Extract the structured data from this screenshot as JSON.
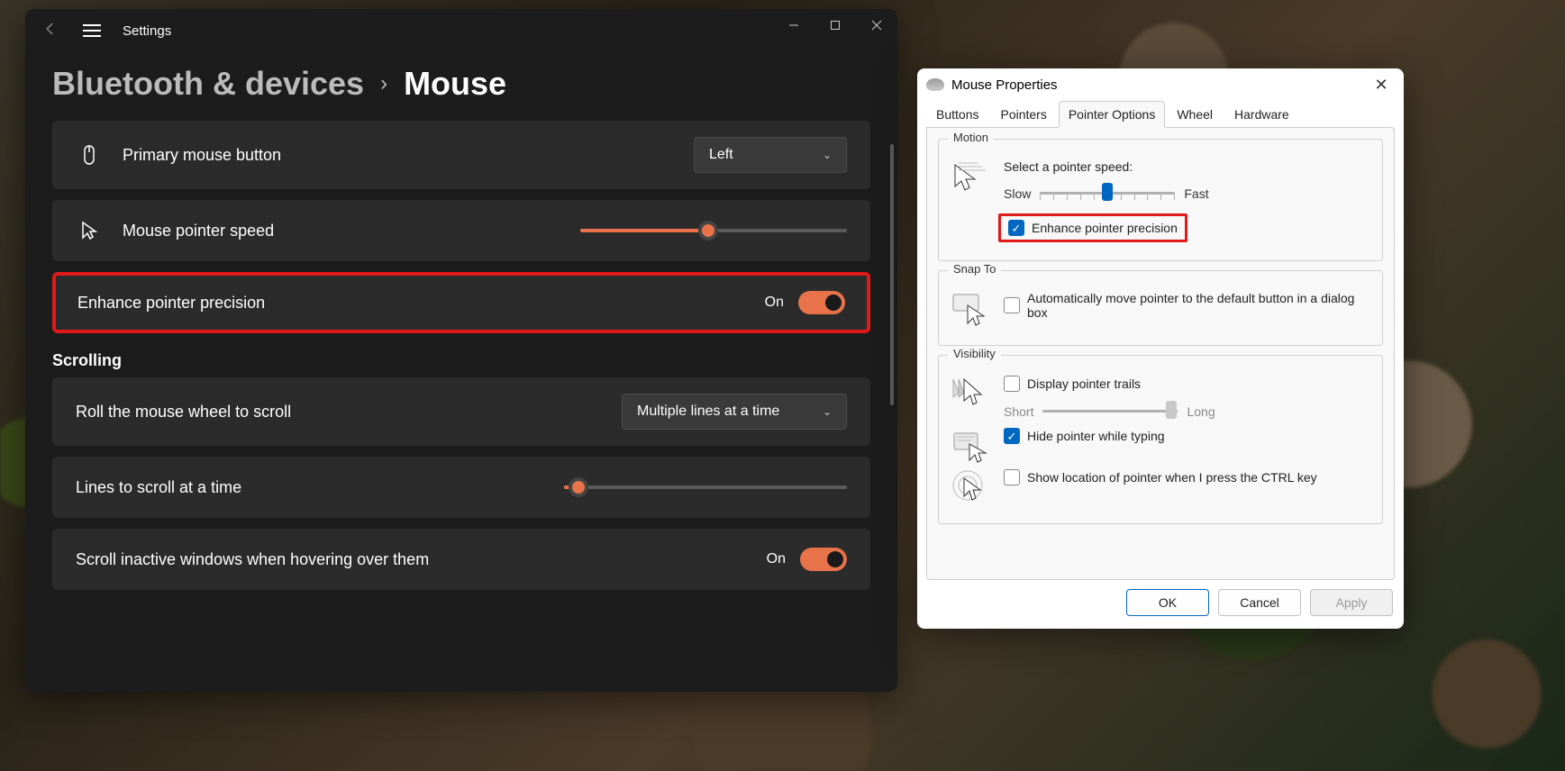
{
  "settings": {
    "app_title": "Settings",
    "breadcrumb_parent": "Bluetooth & devices",
    "breadcrumb_current": "Mouse",
    "primary_button_label": "Primary mouse button",
    "primary_button_value": "Left",
    "pointer_speed_label": "Mouse pointer speed",
    "pointer_speed_value_pct": 48,
    "enhance_precision_label": "Enhance pointer precision",
    "enhance_precision_state": "On",
    "scrolling_section": "Scrolling",
    "roll_wheel_label": "Roll the mouse wheel to scroll",
    "roll_wheel_value": "Multiple lines at a time",
    "lines_scroll_label": "Lines to scroll at a time",
    "lines_scroll_value_pct": 5,
    "scroll_inactive_label": "Scroll inactive windows when hovering over them",
    "scroll_inactive_state": "On"
  },
  "props": {
    "title": "Mouse Properties",
    "tabs": [
      "Buttons",
      "Pointers",
      "Pointer Options",
      "Wheel",
      "Hardware"
    ],
    "active_tab": "Pointer Options",
    "motion": {
      "legend": "Motion",
      "speed_label": "Select a pointer speed:",
      "slow": "Slow",
      "fast": "Fast",
      "speed_pos_pct": 50,
      "enhance_label": "Enhance pointer precision",
      "enhance_checked": true
    },
    "snapto": {
      "legend": "Snap To",
      "auto_label": "Automatically move pointer to the default button in a dialog box",
      "auto_checked": false
    },
    "visibility": {
      "legend": "Visibility",
      "trails_label": "Display pointer trails",
      "trails_checked": false,
      "short": "Short",
      "long": "Long",
      "trails_pos_pct": 95,
      "hide_label": "Hide pointer while typing",
      "hide_checked": true,
      "ctrl_label": "Show location of pointer when I press the CTRL key",
      "ctrl_checked": false
    },
    "buttons": {
      "ok": "OK",
      "cancel": "Cancel",
      "apply": "Apply"
    }
  }
}
